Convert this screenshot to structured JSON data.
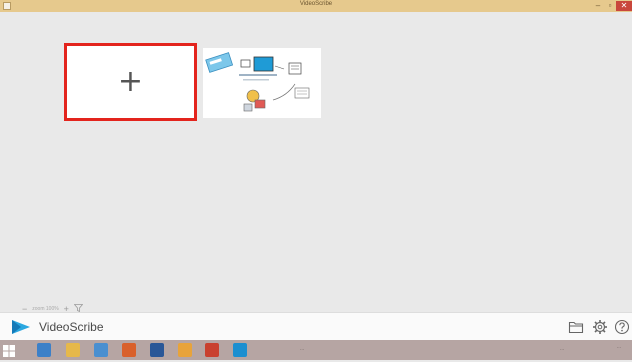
{
  "window": {
    "title": "VideoScribe",
    "controls": {
      "minimize": "–",
      "maximize": "▫",
      "close": "✕"
    }
  },
  "projects": {
    "new_project": {
      "symbol": "+",
      "icon": "plus-icon"
    },
    "items": [
      {
        "icon": "project-thumbnail"
      }
    ]
  },
  "zoom": {
    "out_symbol": "−",
    "value": "zoom 100%",
    "in_symbol": "+",
    "filter_icon": "filter-icon"
  },
  "footer": {
    "brand": "VideoScribe",
    "logo_color": "#2aa7e0",
    "icons": [
      "folder-icon",
      "gear-icon",
      "help-icon"
    ]
  },
  "taskbar": {
    "apps": [
      {
        "icon": "explorer-icon",
        "color": "#3c80c8"
      },
      {
        "icon": "folder-icon",
        "color": "#e6b84a"
      },
      {
        "icon": "media-icon",
        "color": "#4a8fd0"
      },
      {
        "icon": "firefox-icon",
        "color": "#d9602b"
      },
      {
        "icon": "word-icon",
        "color": "#2b5797"
      },
      {
        "icon": "app-icon",
        "color": "#e8a33a"
      },
      {
        "icon": "powerpoint-icon",
        "color": "#c9412f"
      },
      {
        "icon": "videoscribe-icon",
        "color": "#1d8fd0"
      }
    ],
    "center_text": "...",
    "tray_text": "...",
    "clock": "..."
  },
  "colors": {
    "accent_red": "#e3241d",
    "titlebar": "#e6c98d"
  }
}
